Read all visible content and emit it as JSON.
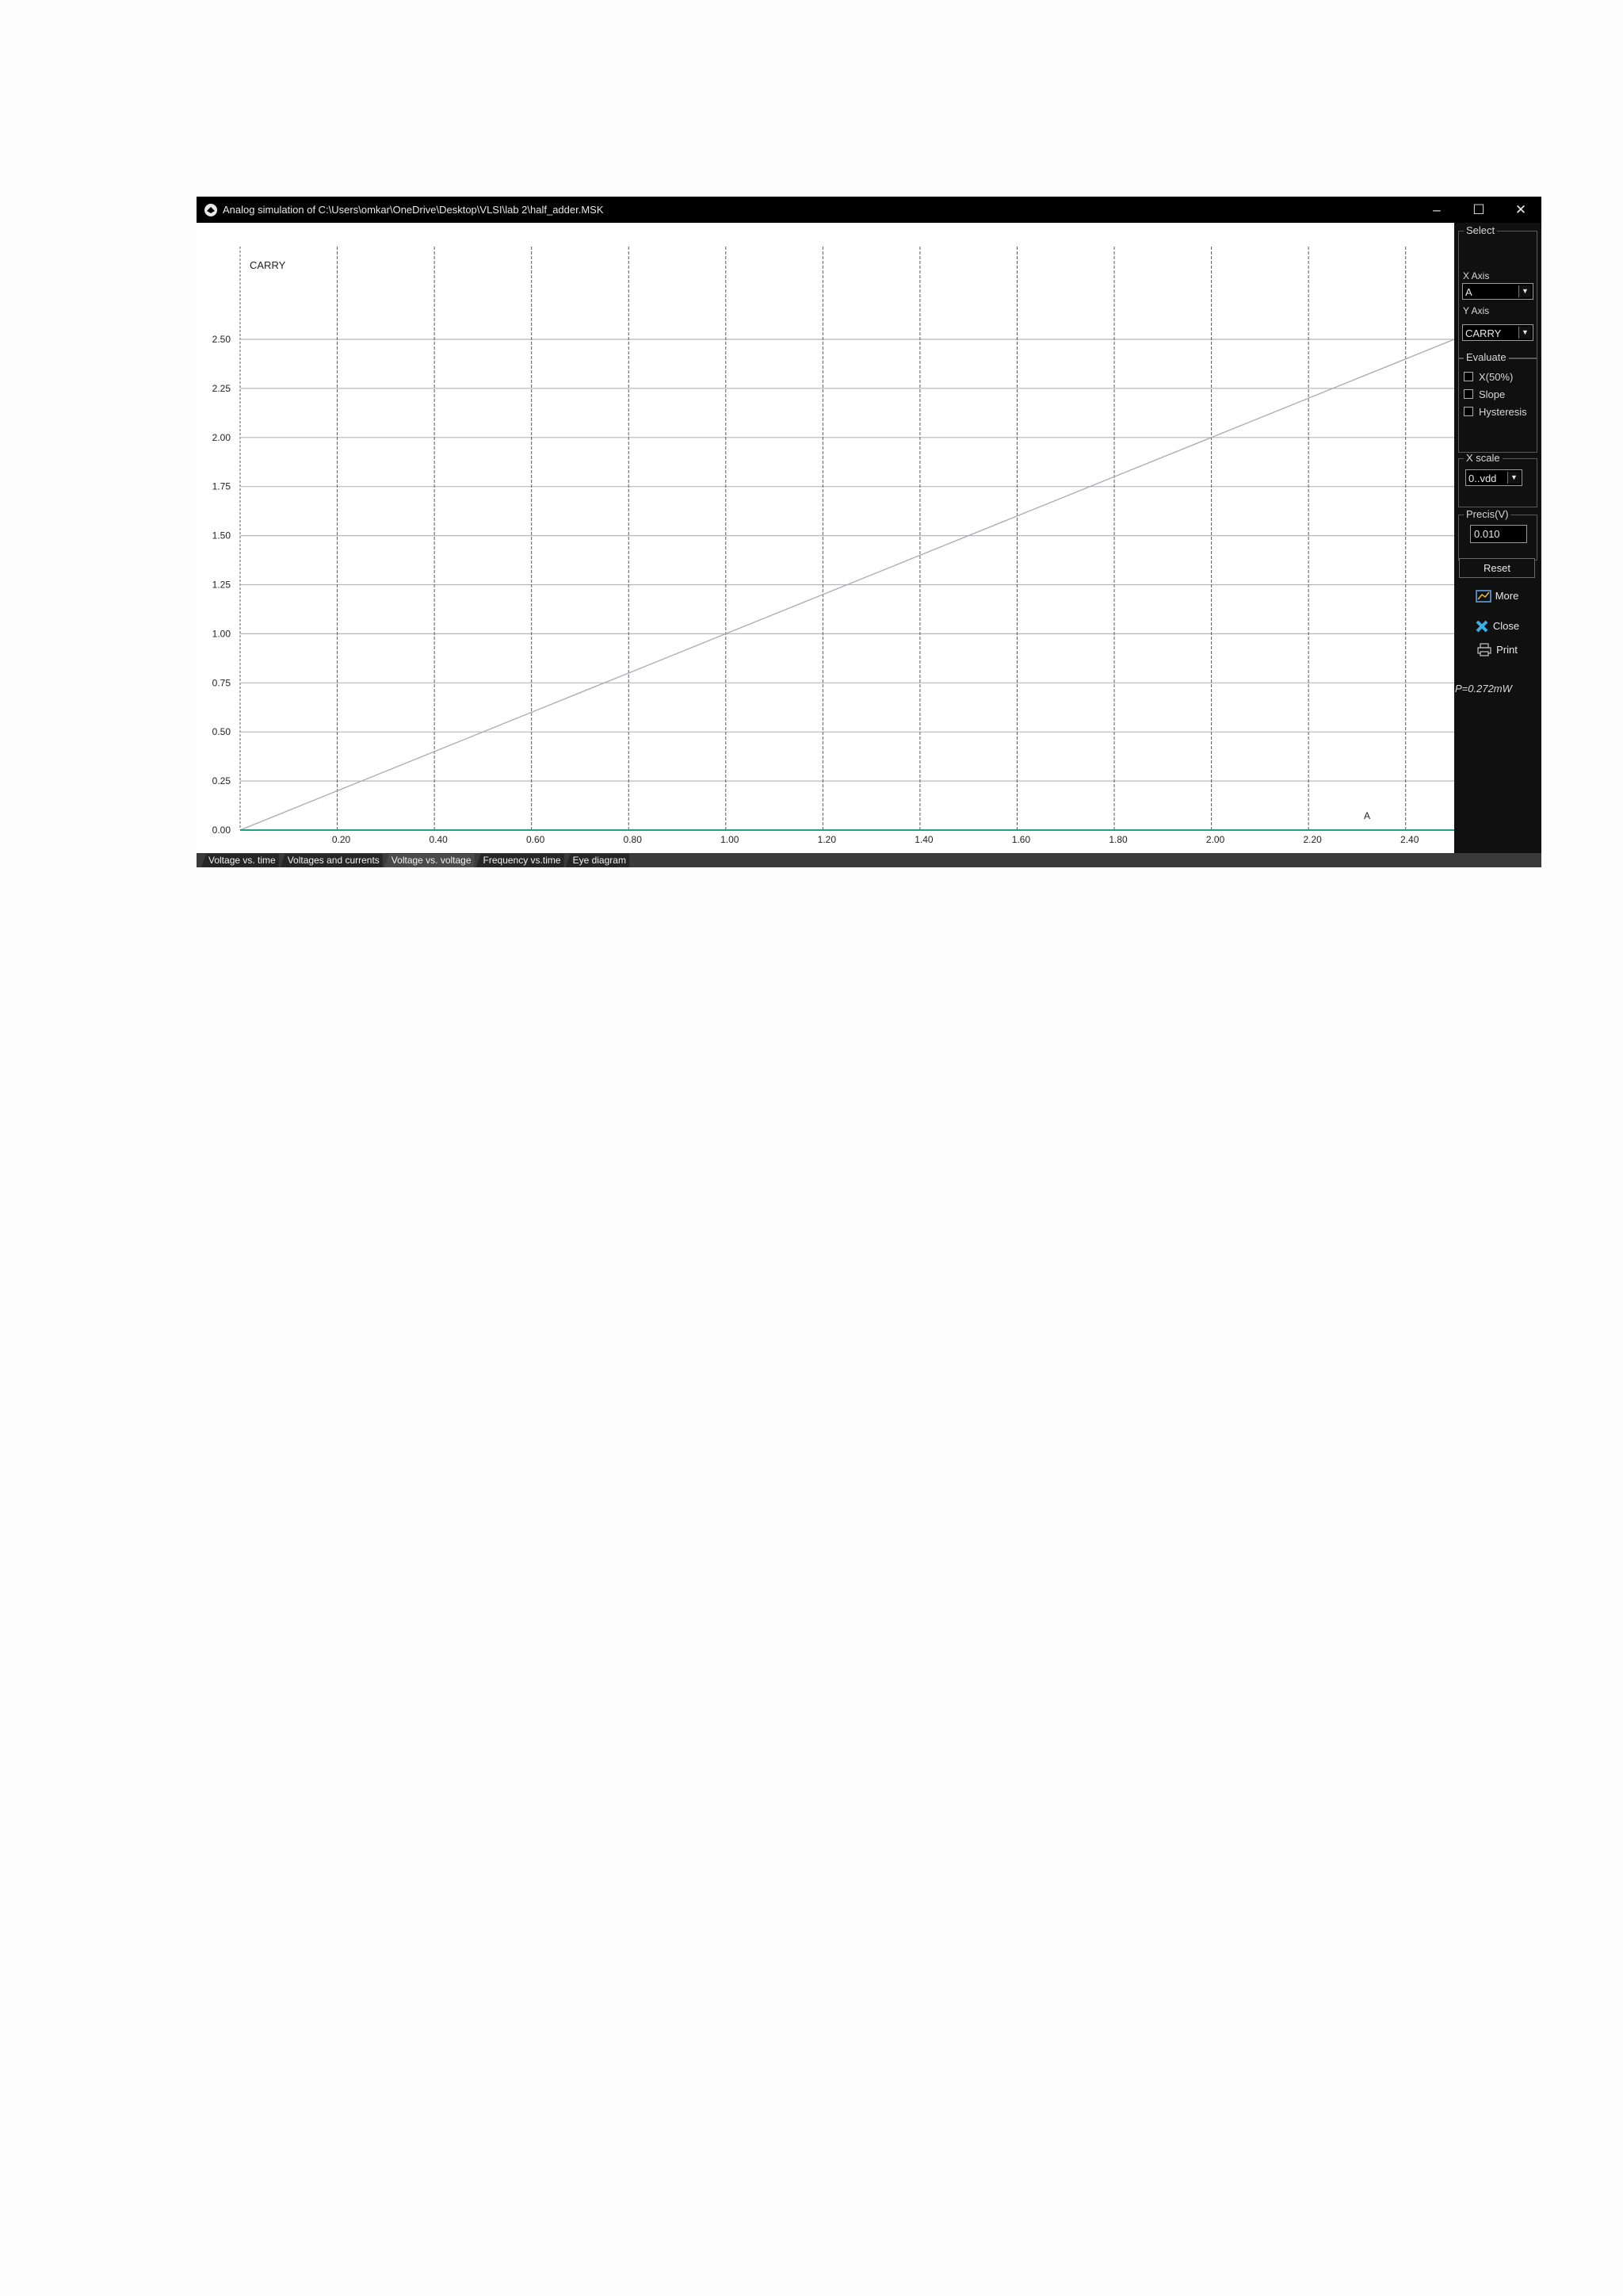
{
  "window": {
    "title": "Analog simulation of C:\\Users\\omkar\\OneDrive\\Desktop\\VLSI\\lab 2\\half_adder.MSK",
    "minimize_glyph": "–",
    "maximize_glyph": "☐",
    "close_glyph": "✕"
  },
  "side_panel": {
    "select_legend": "Select",
    "x_axis_label": "X Axis",
    "x_axis_value": "A",
    "y_axis_label": "Y Axis",
    "y_axis_value": "CARRY",
    "evaluate_legend": "Evaluate",
    "evaluate_options": [
      "X(50%)",
      "Slope",
      "Hysteresis"
    ],
    "x_scale_legend": "X scale",
    "x_scale_value": "0..vdd",
    "precis_legend": "Precis(V)",
    "precis_value": "0.010",
    "reset_label": "Reset",
    "more_label": "More",
    "close_label": "Close",
    "print_label": "Print",
    "power_text": "P=0.272mW"
  },
  "tabs": [
    "Voltage vs. time",
    "Voltages and currents",
    "Voltage vs. voltage",
    "Frequency vs.time",
    "Eye diagram"
  ],
  "active_tab_index": 2,
  "icons": {
    "app": "app-icon",
    "more": "chart-icon",
    "close": "x-icon",
    "print": "printer-icon"
  },
  "chart_data": {
    "type": "line",
    "title": "",
    "signal_label": "CARRY",
    "x_signal_label": "A",
    "xlabel": "",
    "ylabel": "",
    "xlim": [
      0,
      2.5
    ],
    "ylim": [
      0,
      2.5
    ],
    "x_ticks": [
      "0.20",
      "0.40",
      "0.60",
      "0.80",
      "1.00",
      "1.20",
      "1.40",
      "1.60",
      "1.80",
      "2.00",
      "2.20",
      "2.40"
    ],
    "y_ticks": [
      "0.00",
      "0.25",
      "0.50",
      "0.75",
      "1.00",
      "1.25",
      "1.50",
      "1.75",
      "2.00",
      "2.25",
      "2.50"
    ],
    "grid": true,
    "series": [
      {
        "name": "",
        "x": [
          0,
          2.5
        ],
        "y": [
          0,
          2.5
        ],
        "color": "#a9a9b4"
      },
      {
        "name": "",
        "x": [
          0,
          2.5
        ],
        "y": [
          0,
          0
        ],
        "color": "#2a9a8a"
      }
    ]
  }
}
